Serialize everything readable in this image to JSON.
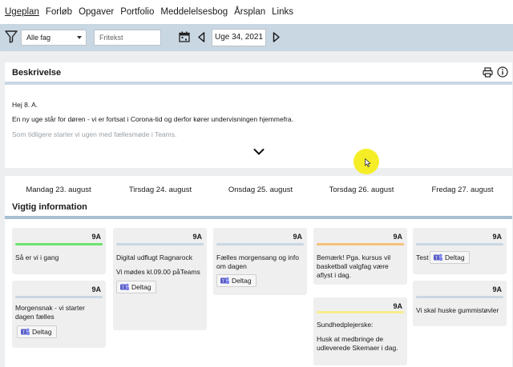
{
  "nav": [
    "Ugeplan",
    "Forløb",
    "Opgaver",
    "Portfolio",
    "Meddelelsesbog",
    "Årsplan",
    "Links"
  ],
  "toolbar": {
    "subject_value": "Alle fag",
    "search_placeholder": "Fritekst",
    "week_label": "Uge 34, 2021"
  },
  "description": {
    "title": "Beskrivelse",
    "lines": [
      "Hej 8. A.",
      "En ny uge står for døren - vi er fortsat i Corona-tid og derfor kører undervisningen hjemmefra.",
      "Som tidligere starter vi ugen med fællesmøde i Teams."
    ]
  },
  "week": {
    "days": [
      "Mandag 23. august",
      "Tirsdag 24. august",
      "Onsdag 25. august",
      "Torsdag 26. august",
      "Fredag 27. august"
    ],
    "section_title": "Vigtig information",
    "teams_label": "Deltag",
    "cards": [
      {
        "class": "9A",
        "color": "#6ee26e",
        "lines": [
          "Så er vi i gang"
        ]
      },
      {
        "class": "9A",
        "color": "#c9d7e3",
        "lines": [
          "Morgensnak - vi starter",
          "dagen fælles"
        ]
      },
      {
        "class": "9A",
        "color": "#c9d7e3",
        "lines": [
          "Digital udflugt Ragnarock"
        ],
        "lines2": [
          "Vi mødes kl.09.00 påTeams"
        ]
      },
      {
        "class": "9A",
        "color": "#c9d7e3",
        "lines": [
          "Fælles morgensang og info",
          "om dagen"
        ]
      },
      {
        "class": "9A",
        "color": "#f5c27a",
        "lines": [
          "Bemærk! Pga. kursus vil",
          "basketball valgfag være",
          "aflyst i dag."
        ]
      },
      {
        "class": "9A",
        "color": "#f5ee8a",
        "lines": [
          "Sundhedplejerske:"
        ],
        "lines2": [
          "Husk at medbringe de",
          "udleverede Skemaer i dag."
        ]
      },
      {
        "class": "9A",
        "color": "#c9d7e3",
        "lines": [
          "Test"
        ]
      },
      {
        "class": "9A",
        "color": "#c9d7e3",
        "lines": [
          "Vi skal huske gummistøvler"
        ]
      }
    ]
  },
  "colors": {
    "accent": "#c9d7e3",
    "teams": "#5b5fc7",
    "highlight": "#f5ee1c"
  }
}
